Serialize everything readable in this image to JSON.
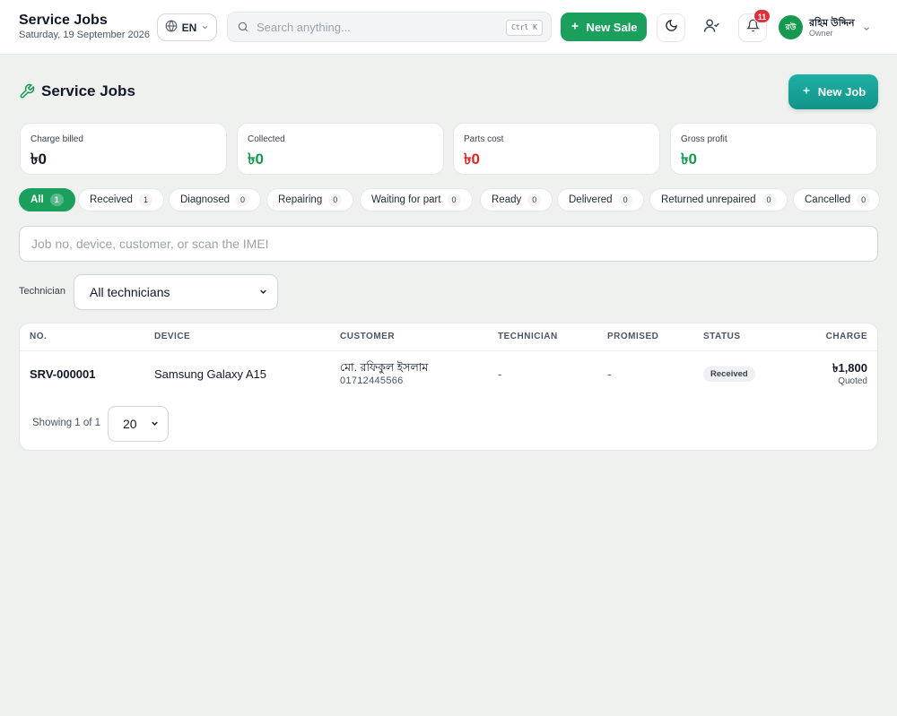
{
  "header": {
    "title": "Service Jobs",
    "date": "Saturday, 19 September 2026",
    "language": "EN",
    "search_placeholder": "Search anything...",
    "search_shortcut": "Ctrl K",
    "new_sale_label": "New Sale",
    "notification_count": "11",
    "user": {
      "initials": "রউ",
      "name": "রহিম উদ্দিন",
      "role": "Owner"
    }
  },
  "page": {
    "title": "Service Jobs",
    "new_job_label": "New Job"
  },
  "stats": [
    {
      "label": "Charge billed",
      "value": "৳0",
      "color": "#111827"
    },
    {
      "label": "Collected",
      "value": "৳0",
      "color": "#15994f"
    },
    {
      "label": "Parts cost",
      "value": "৳0",
      "color": "#dc2626"
    },
    {
      "label": "Gross profit",
      "value": "৳0",
      "color": "#15994f"
    }
  ],
  "filters": [
    {
      "label": "All",
      "count": "1",
      "active": true
    },
    {
      "label": "Received",
      "count": "1"
    },
    {
      "label": "Diagnosed",
      "count": "0"
    },
    {
      "label": "Repairing",
      "count": "0"
    },
    {
      "label": "Waiting for part",
      "count": "0"
    },
    {
      "label": "Ready",
      "count": "0"
    },
    {
      "label": "Delivered",
      "count": "0"
    },
    {
      "label": "Returned unrepaired",
      "count": "0"
    },
    {
      "label": "Cancelled",
      "count": "0"
    }
  ],
  "job_search": {
    "placeholder": "Job no, device, customer, or scan the IMEI"
  },
  "technician_filter": {
    "label": "Technician",
    "selected": "All technicians"
  },
  "table": {
    "columns": [
      "NO.",
      "DEVICE",
      "CUSTOMER",
      "TECHNICIAN",
      "PROMISED",
      "STATUS",
      "CHARGE"
    ],
    "rows": [
      {
        "no": "SRV-000001",
        "device": "Samsung Galaxy A15",
        "customer_name": "মো. রফিকুল ইসলাম",
        "customer_phone": "01712445566",
        "technician": "-",
        "promised": "-",
        "status": "Received",
        "charge": "৳1,800",
        "charge_note": "Quoted"
      }
    ]
  },
  "pagination": {
    "showing": "Showing 1 of 1",
    "page_size": "20"
  },
  "colors": {
    "brand_green": "#1a9f5c",
    "teal": "#129488",
    "danger": "#dc2626",
    "background": "#eff1ef"
  }
}
